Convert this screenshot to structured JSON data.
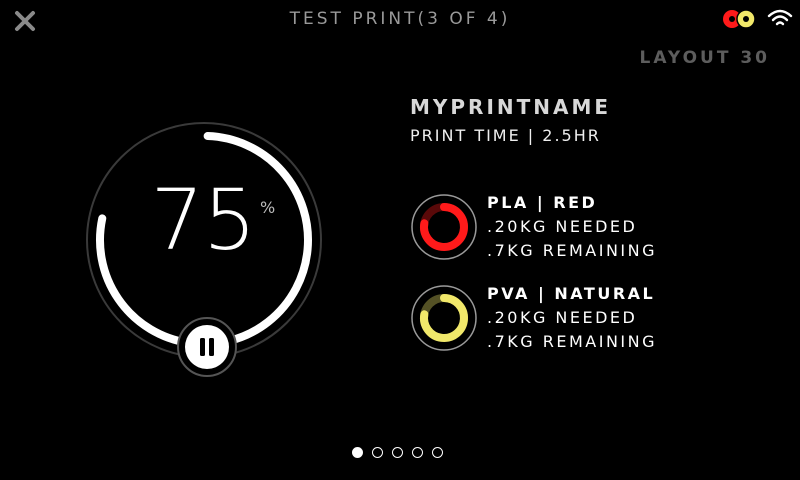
{
  "header": {
    "title": "TEST PRINT(3 OF 4)",
    "close_icon": "close-icon",
    "filament_status_icon": "filament-spools-icon",
    "wifi_icon": "wifi-icon"
  },
  "layout_label": "LAYOUT 30",
  "progress": {
    "value": "75",
    "unit": "%",
    "fraction": 0.75,
    "pause_icon": "pause-icon"
  },
  "print": {
    "name": "MYPRINTNAME",
    "time": "PRINT TIME | 2.5HR"
  },
  "materials": [
    {
      "name": "PLA | RED",
      "needed": ".20KG NEEDED",
      "remaining": ".7KG REMAINING",
      "color": "#ff1a1a",
      "fraction": 0.78
    },
    {
      "name": "PVA | NATURAL",
      "needed": ".20KG NEEDED",
      "remaining": ".7KG REMAINING",
      "color": "#f1e86a",
      "fraction": 0.78
    }
  ],
  "pager": {
    "count": 5,
    "active_index": 0
  },
  "colors": {
    "background": "#000000",
    "accent_red": "#ff1a1a",
    "accent_yellow": "#f1e86a",
    "text_primary": "#ffffff",
    "text_dim": "#9a9a9a"
  }
}
